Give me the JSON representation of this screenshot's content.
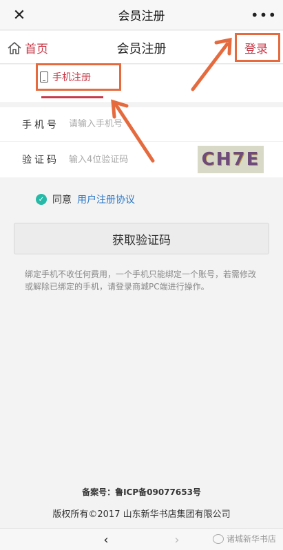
{
  "wechat_bar": {
    "title": "会员注册",
    "close_glyph": "✕",
    "more_glyph": "•••"
  },
  "header": {
    "home_label": "首页",
    "title": "会员注册",
    "login_label": "登录"
  },
  "tab": {
    "label": "手机注册"
  },
  "form": {
    "phone_label": "手机号",
    "phone_placeholder": "请输入手机号",
    "code_label": "验证码",
    "code_placeholder": "输入4位验证码",
    "captcha_text": "CH7E"
  },
  "agreement": {
    "text": "同意",
    "link": "用户注册协议"
  },
  "submit_label": "获取验证码",
  "notice": "绑定手机不收任何费用，一个手机只能绑定一个账号，若需修改或解除已绑定的手机，请登录商城PC端进行操作。",
  "footer": {
    "record": "备案号：鲁ICP备09077653号",
    "copyright": "版权所有©2017  山东新华书店集团有限公司"
  },
  "bottom_bar": {
    "back_glyph": "‹",
    "forward_glyph": "›",
    "watermark": "诸城新华书店"
  },
  "colors": {
    "accent_red": "#c63a48",
    "annotation_orange": "#e56b3e",
    "link_blue": "#2c78c7",
    "check_green": "#27b9a7"
  }
}
